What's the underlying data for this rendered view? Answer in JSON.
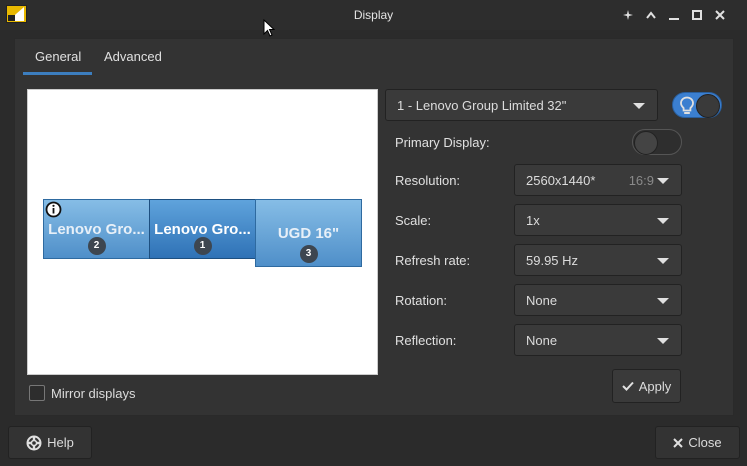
{
  "window": {
    "title": "Display"
  },
  "tabs": [
    {
      "label": "General",
      "active": true
    },
    {
      "label": "Advanced",
      "active": false
    }
  ],
  "monitors": [
    {
      "label": "Lenovo Gro...",
      "number": "2",
      "selected": false
    },
    {
      "label": "Lenovo Gro...",
      "number": "1",
      "selected": true
    },
    {
      "label": "UGD 16\"",
      "number": "3",
      "selected": false
    }
  ],
  "mirror": {
    "label": "Mirror displays",
    "checked": false
  },
  "monitor_select": {
    "value": "1 - Lenovo Group Limited 32\""
  },
  "enabled_toggle": {
    "on": true
  },
  "primary": {
    "label": "Primary Display:",
    "on": false
  },
  "resolution": {
    "label": "Resolution:",
    "value": "2560x1440*",
    "ratio": "16:9"
  },
  "scale": {
    "label": "Scale:",
    "value": "1x"
  },
  "refresh": {
    "label": "Refresh rate:",
    "value": "59.95 Hz"
  },
  "rotation": {
    "label": "Rotation:",
    "value": "None"
  },
  "reflection": {
    "label": "Reflection:",
    "value": "None"
  },
  "buttons": {
    "apply": "Apply",
    "help": "Help",
    "close": "Close"
  },
  "colors": {
    "accent": "#3c7ebf",
    "toggle_on": "#3b7fd0"
  }
}
